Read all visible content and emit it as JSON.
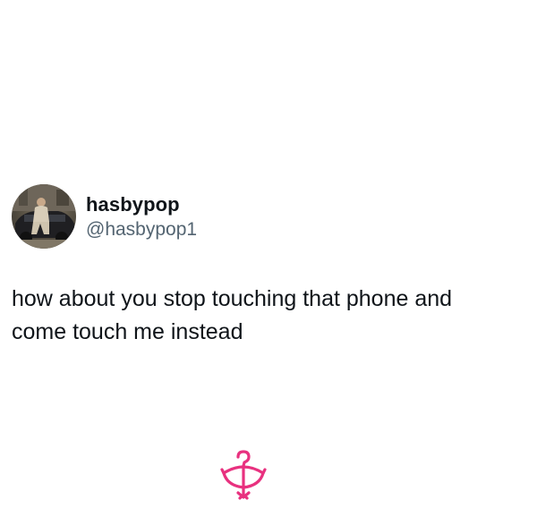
{
  "tweet": {
    "display_name": "hasbypop",
    "handle": "@hasbypop1",
    "text": "how about you stop touching that phone and come touch me instead"
  },
  "icons": {
    "avatar": "profile-photo",
    "brand_logo": "pink-bow-arrow-logo"
  },
  "colors": {
    "text_primary": "#0f1419",
    "text_secondary": "#536471",
    "brand_pink": "#e8317f",
    "background": "#ffffff"
  }
}
